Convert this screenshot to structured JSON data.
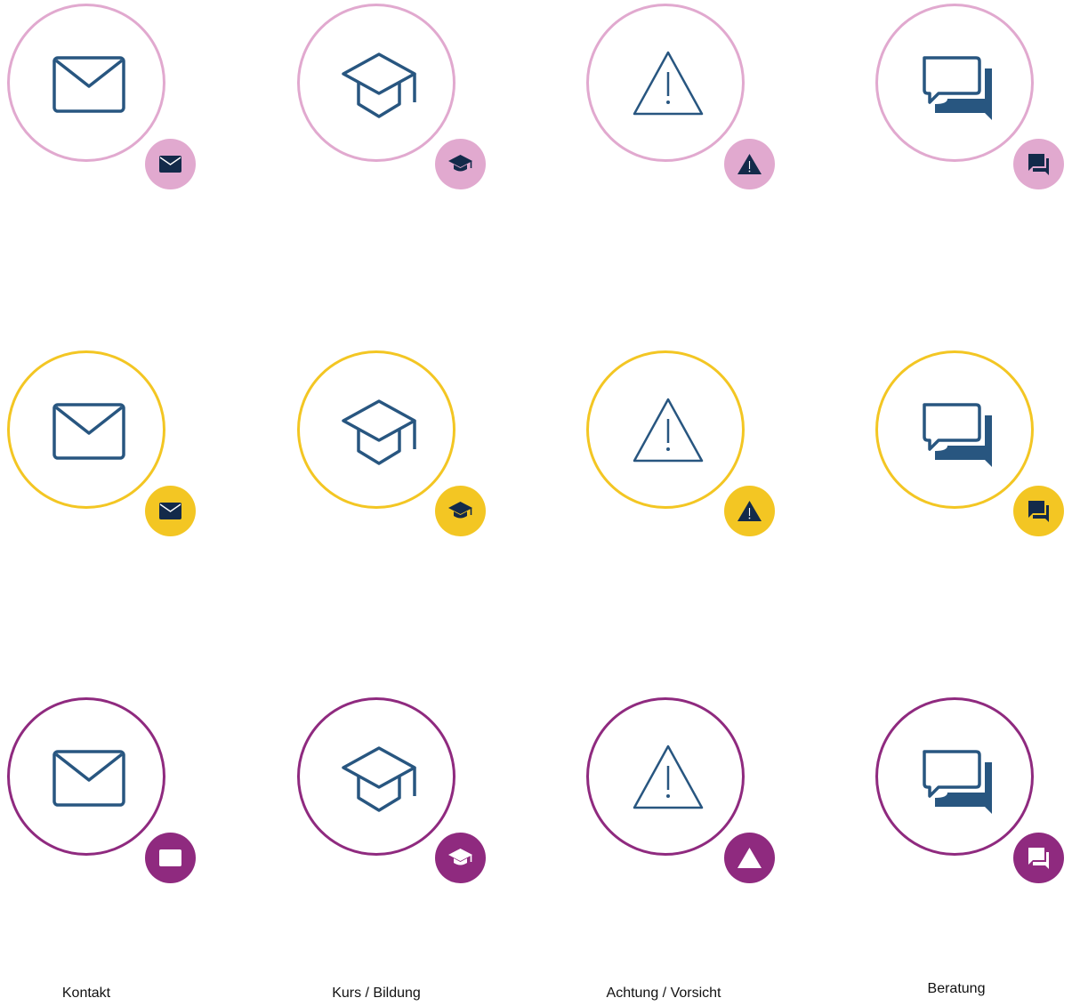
{
  "colors": {
    "icon": "#285680",
    "badge_icon": "#132a4a",
    "rows": [
      "#e1a9cf",
      "#f3c623",
      "#8f2a7f"
    ]
  },
  "rows": [
    {
      "name": "pink",
      "ring_color": "#e1a9cf",
      "badge_color": "#e1a9cf",
      "badge_glyph_color": "#132a4a"
    },
    {
      "name": "yellow",
      "ring_color": "#f3c623",
      "badge_color": "#f3c623",
      "badge_glyph_color": "#132a4a"
    },
    {
      "name": "purple",
      "ring_color": "#8f2a7f",
      "badge_color": "#8f2a7f",
      "badge_glyph_color": "#ffffff"
    }
  ],
  "columns": [
    {
      "icon": "envelope-icon",
      "label": "Kontakt"
    },
    {
      "icon": "graduation-cap-icon",
      "label": "Kurs / Bildung"
    },
    {
      "icon": "warning-triangle-icon",
      "label": "Achtung / Vorsicht"
    },
    {
      "icon": "chat-bubbles-icon",
      "label": "Beratung"
    }
  ]
}
